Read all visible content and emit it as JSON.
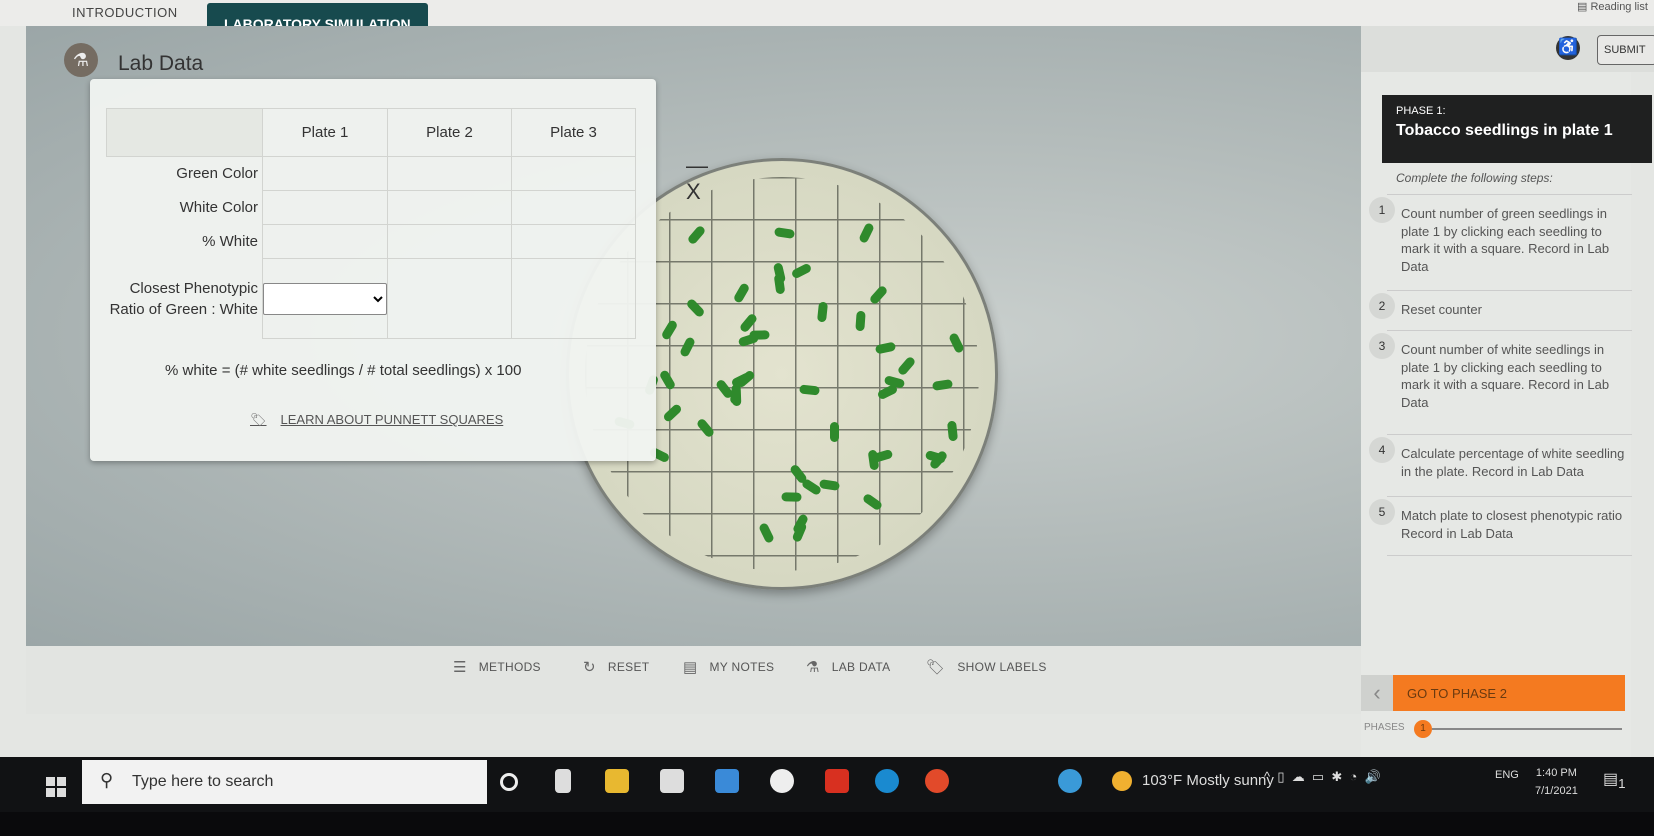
{
  "browser": {
    "reading_list": "Reading list"
  },
  "tabs": [
    {
      "label": "INTRODUCTION",
      "active": false
    },
    {
      "label": "LABORATORY SIMULATION",
      "active": true
    }
  ],
  "header": {
    "submit": "SUBMIT",
    "accessibility_icon": "accessibility-icon"
  },
  "lab_data": {
    "title": "Lab Data",
    "minimize": "—",
    "close": "X",
    "columns": [
      "Plate 1",
      "Plate 2",
      "Plate 3"
    ],
    "rows": [
      "Green Color",
      "White Color",
      "% White",
      "Closest Phenotypic Ratio of Green : White"
    ],
    "ratio_select_value": "",
    "formula": "% white = (# white seedlings / # total seedlings) x 100",
    "learn_link": "LEARN ABOUT PUNNETT SQUARES"
  },
  "toolbar": [
    {
      "label": "METHODS",
      "icon": "☰"
    },
    {
      "label": "RESET",
      "icon": "↻"
    },
    {
      "label": "MY NOTES",
      "icon": "▤"
    },
    {
      "label": "LAB DATA",
      "icon": "⚗"
    },
    {
      "label": "SHOW LABELS",
      "icon": "🏷"
    }
  ],
  "phase": {
    "subtitle": "PHASE 1:",
    "title": "Tobacco seedlings in plate 1",
    "instructions": "Complete the following steps:",
    "steps": [
      {
        "n": "1",
        "text": "Count number of green seedlings in plate 1 by clicking each seedling to mark it with a square. Record in Lab Data"
      },
      {
        "n": "2",
        "text": "Reset counter"
      },
      {
        "n": "3",
        "text": "Count number of white seedlings in plate 1 by clicking each seedling to mark it with a square. Record in Lab Data"
      },
      {
        "n": "4",
        "text": "Calculate percentage of white seedling in the plate. Record in Lab Data"
      },
      {
        "n": "5",
        "text": "Match plate to closest phenotypic ratio Record in Lab Data"
      }
    ],
    "next": "GO TO PHASE 2",
    "phases_label": "PHASES",
    "current_phase": "1",
    "accent": "#f47a20"
  },
  "taskbar": {
    "search_placeholder": "Type here to search",
    "weather": "103°F  Mostly sunny",
    "lang": "ENG",
    "time": "1:40 PM",
    "date": "7/1/2021",
    "notifications": "1"
  }
}
